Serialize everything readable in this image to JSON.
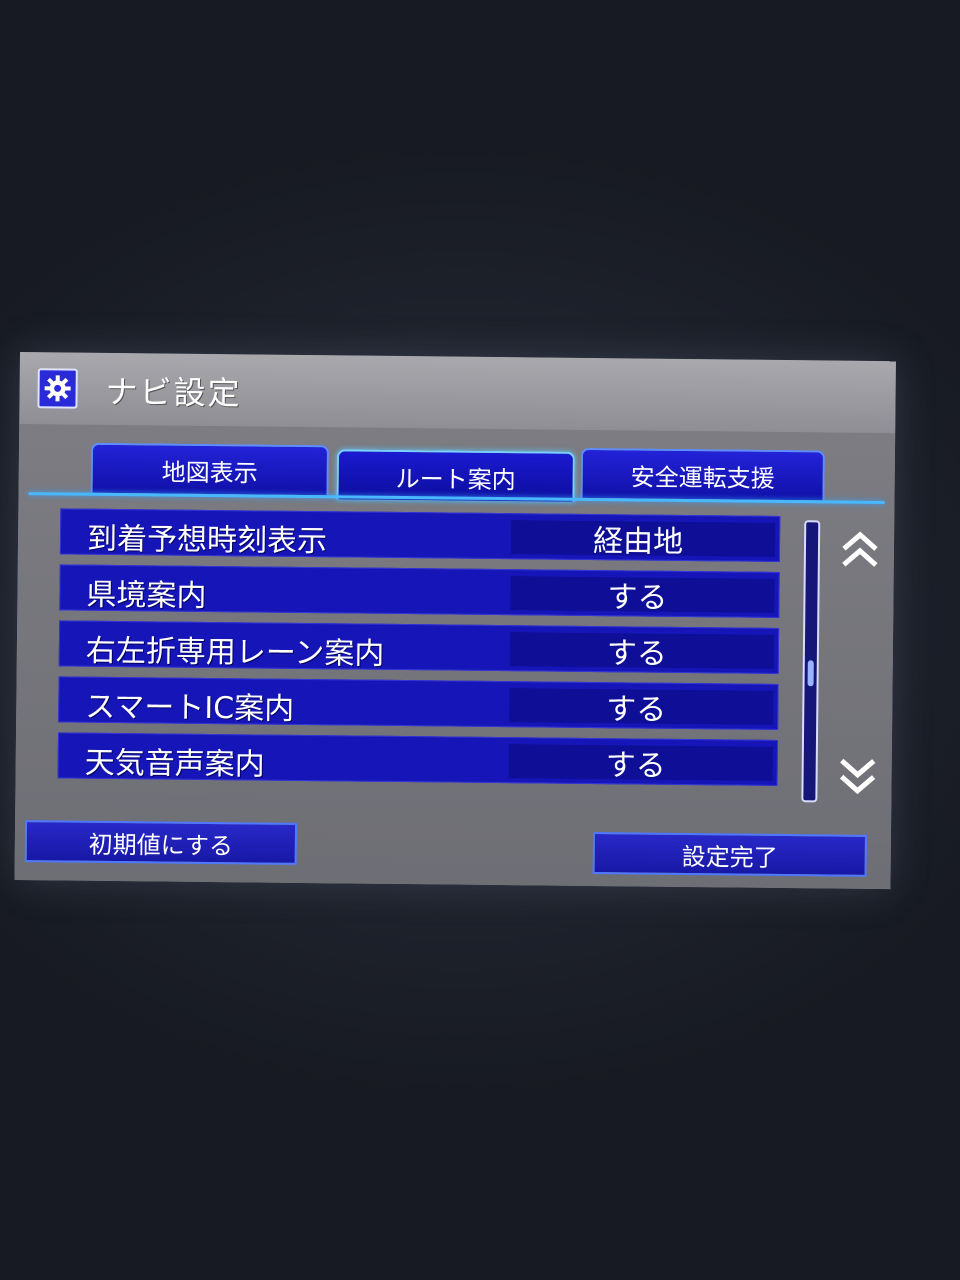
{
  "window": {
    "title": "ナビ設定",
    "icon": "gear-icon"
  },
  "tabs": [
    {
      "label": "地図表示",
      "active": false
    },
    {
      "label": "ルート案内",
      "active": true
    },
    {
      "label": "安全運転支援",
      "active": false
    }
  ],
  "settings": [
    {
      "label": "到着予想時刻表示",
      "value": "経由地"
    },
    {
      "label": "県境案内",
      "value": "する"
    },
    {
      "label": "右左折専用レーン案内",
      "value": "する"
    },
    {
      "label": "スマートIC案内",
      "value": "する"
    },
    {
      "label": "天気音声案内",
      "value": "する"
    }
  ],
  "scroll": {
    "up_icon": "double-chevron-up-icon",
    "down_icon": "double-chevron-down-icon",
    "position": 0.55
  },
  "footer": {
    "reset_label": "初期値にする",
    "done_label": "設定完了"
  },
  "colors": {
    "accent": "#1616b8",
    "tab_highlight": "#4ab8ff",
    "frame": "#8a8a90"
  }
}
